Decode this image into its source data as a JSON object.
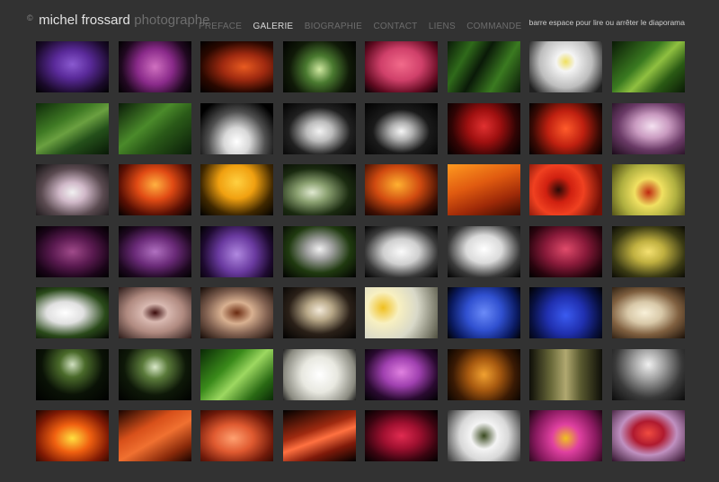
{
  "header": {
    "copyright": "©",
    "name": "michel frossard",
    "role": "photographe",
    "hint": "barre espace pour lire ou arrêter le diaporama"
  },
  "nav": [
    {
      "label": "PREFACE",
      "active": false
    },
    {
      "label": "GALERIE",
      "active": true
    },
    {
      "label": "BIOGRAPHIE",
      "active": false
    },
    {
      "label": "CONTACT",
      "active": false
    },
    {
      "label": "LIENS",
      "active": false
    },
    {
      "label": "COMMANDE",
      "active": false
    }
  ],
  "gallery": [
    "radial-gradient(ellipse at 50% 45%, #8a5ad0 0%, #5a2a9a 35%, #1a0a2a 75%, #000 100%)",
    "radial-gradient(circle at 50% 50%, #d070c0 0%, #8a2a8a 40%, #200820 75%, #000 100%)",
    "radial-gradient(ellipse at 60% 50%, #e85a20 0%, #a02a10 35%, #2a0800 70%, #000 100%)",
    "radial-gradient(circle at 50% 55%, #cfe8a0 0%, #4a7a30 30%, #101a08 65%, #000 100%)",
    "radial-gradient(ellipse at 50% 45%, #f26a8a 0%, #d0406a 40%, #600a20 75%, #000 100%)",
    "linear-gradient(120deg, #0a1a08 0%, #2f6a1a 25%, #0a1a08 45%, #3a7a20 70%, #0a1a08 100%)",
    "radial-gradient(circle at 50% 40%, #f0e060 0%, #f4f4f4 20%, #bdbdbd 55%, #202020 90%)",
    "linear-gradient(135deg, #0a1a06 0%, #3a7a20 40%, #8fc040 55%, #2a5a14 75%, #0a1a06 100%)",
    "linear-gradient(150deg, #0e2a0a 0%, #3f7a24 35%, #6aa040 50%, #24501a 70%, #081806 100%)",
    "linear-gradient(140deg, #0a1c08 0%, #4a8a2a 40%, #2a5a18 60%, #0a1c08 100%)",
    "radial-gradient(ellipse at 50% 75%, #ffffff 0%, #d8d8d8 25%, #505050 55%, #000 85%)",
    "radial-gradient(ellipse at 50% 55%, #f2f2f2 0%, #bcbcbc 25%, #202020 60%, #000 100%)",
    "radial-gradient(ellipse at 50% 55%, #f5f5f5 0%, #b0b0b0 22%, #1a1a1a 55%, #000 100%)",
    "radial-gradient(circle at 50% 45%, #e03030 0%, #a01010 35%, #300404 70%, #000 100%)",
    "radial-gradient(circle at 50% 50%, #ff5a2a 0%, #c02010 40%, #3a0a04 75%, #000 100%)",
    "radial-gradient(ellipse at 55% 45%, #f4e0f0 0%, #c99ac0 30%, #6a3a66 60%, #1a0a18 100%)",
    "radial-gradient(ellipse at 50% 55%, #f0f0f0 0%, #d0b8c8 25%, #5a4a50 60%, #101010 100%)",
    "radial-gradient(ellipse at 50% 40%, #ffb040 0%, #e04a14 35%, #5a1004 70%, #000 100%)",
    "radial-gradient(ellipse at 50% 35%, #ffd040 0%, #f0a010 35%, #402800 70%, #000 100%)",
    "radial-gradient(ellipse at 40% 55%, #dfe8d0 0%, #8aa070 25%, #1a2a10 60%, #000 100%)",
    "radial-gradient(ellipse at 45% 40%, #ffb030 0%, #d04a10 40%, #401004 75%, #000 100%)",
    "linear-gradient(160deg, #ff9a20 0%, #e05a10 40%, #a02a08 70%, #3a0a00 100%)",
    "radial-gradient(circle at 40% 50%, #2a0a06 0%, #d02010 25%, #f04020 50%, #701006 85%)",
    "radial-gradient(circle at 50% 55%, #c02a10 0%, #f0e060 30%, #b0b040 60%, #404010 100%)",
    "radial-gradient(ellipse at 50% 50%, #a04a8a 0%, #5a1a50 40%, #1a0418 75%, #000 100%)",
    "radial-gradient(ellipse at 50% 50%, #b070c0 0%, #6a2a78 40%, #1e0820 75%, #000 100%)",
    "radial-gradient(circle at 50% 55%, #b088e0 0%, #6a3aa0 40%, #1e0a30 75%, #000 100%)",
    "radial-gradient(ellipse at 50% 45%, #f0f0f0 0%, #a0a0a0 25%, #203a10 60%, #000 100%)",
    "radial-gradient(ellipse at 50% 50%, #fafafa 0%, #cfcfcf 35%, #3a3a3a 70%, #000 100%)",
    "radial-gradient(ellipse at 50% 45%, #ffffff 0%, #dadada 35%, #3a3a3a 70%, #000 100%)",
    "radial-gradient(ellipse at 50% 45%, #e04a6a 0%, #8a1a3a 40%, #2a040e 75%, #000 100%)",
    "radial-gradient(ellipse at 50% 50%, #f4e070 0%, #c0b040 30%, #3a3a14 70%, #0a0a04 100%)",
    "radial-gradient(ellipse at 40% 50%, #ffffff 0%, #e0e0e0 30%, #2a4a1a 65%, #000 100%)",
    "radial-gradient(ellipse at 50% 50%, #3a0a0a 0%, #d8b8b0 25%, #b08a80 55%, #2a1a18 100%)",
    "radial-gradient(ellipse at 50% 50%, #6a2a10 0%, #d8b090 30%, #806050 60%, #140a06 100%)",
    "radial-gradient(ellipse at 50% 45%, #f2e8d8 0%, #b8a888 25%, #2a2018 60%, #000 100%)",
    "radial-gradient(circle at 25% 40%, #f0c020 0%, #f8f0c0 25%, #d8d8c8 55%, #505040 100%)",
    "radial-gradient(circle at 50% 50%, #6a8af8 0%, #3050d0 40%, #0a1a60 75%, #000 100%)",
    "radial-gradient(circle at 50% 55%, #3a5af0 0%, #2030b0 40%, #081040 75%, #000 100%)",
    "radial-gradient(ellipse at 45% 50%, #f8f0d8 0%, #d8c8a8 30%, #806040 60%, #1a1008 100%)",
    "radial-gradient(ellipse at 50% 30%, #d0e0c0 0%, #4a6a2a 25%, #0a1206 60%, #000 100%)",
    "radial-gradient(ellipse at 50% 35%, #d8e8c8 0%, #5a7a3a 25%, #0e1808 60%, #000 100%)",
    "linear-gradient(135deg, #0a2a06 0%, #3a8a1a 35%, #9cd860 55%, #2a6a14 80%, #0a2a06 100%)",
    "radial-gradient(circle at 50% 50%, #ffffff 0%, #e8e8e0 40%, #8a8a80 80%, #202020 100%)",
    "radial-gradient(ellipse at 50% 45%, #e080e0 0%, #a040b0 35%, #2a0a30 70%, #000 100%)",
    "radial-gradient(circle at 50% 50%, #f0a030 0%, #a85a10 35%, #3a1a04 70%, #0a0400 100%)",
    "linear-gradient(90deg, #0e0e08 0%, #6a6a3a 30%, #b0a870 50%, #5a5a30 70%, #0e0e08 100%)",
    "radial-gradient(circle at 50% 30%, #f0f0f0 0%, #a0a0a0 30%, #3a3a3a 65%, #0a0a0a 100%)",
    "radial-gradient(ellipse at 50% 55%, #ffe040 0%, #f06010 35%, #801a04 70%, #1a0400 100%)",
    "linear-gradient(150deg, #1a0400 0%, #d8501a 35%, #f07030 55%, #8a2a0a 80%, #1a0400 100%)",
    "radial-gradient(ellipse at 45% 55%, #ffa070 0%, #e05a30 35%, #701a0a 70%, #1a0400 100%)",
    "linear-gradient(160deg, #000 0%, #a02a10 40%, #ff7040 55%, #801a0a 75%, #000 100%)",
    "radial-gradient(ellipse at 50% 50%, #e02a50 0%, #a01030 35%, #3a0410 70%, #000 100%)",
    "radial-gradient(circle at 50% 50%, #3a4a20 0%, #f4f4f4 30%, #d8d8d8 55%, #303030 100%)",
    "radial-gradient(circle at 50% 55%, #f0c020 0%, #e040a0 30%, #8a1a60 65%, #1a0410 100%)",
    "radial-gradient(ellipse at 50% 45%, #f04a40 0%, #b01a30 30%, #c090c0 55%, #30102a 100%)"
  ]
}
